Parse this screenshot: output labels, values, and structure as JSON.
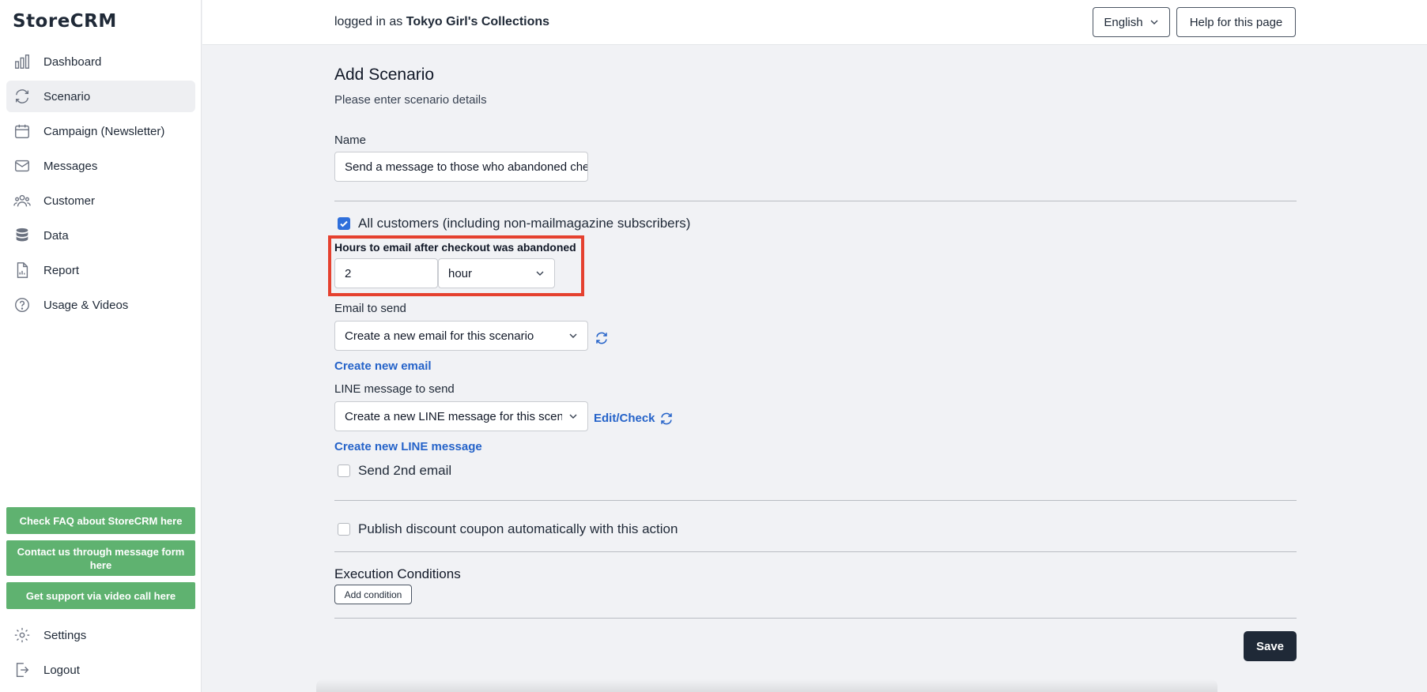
{
  "app": {
    "logo": "StoreCRM"
  },
  "sidebar": {
    "items": [
      {
        "label": "Dashboard",
        "icon": "chart-bars-icon"
      },
      {
        "label": "Scenario",
        "icon": "refresh-icon",
        "active": true
      },
      {
        "label": "Campaign (Newsletter)",
        "icon": "calendar-icon"
      },
      {
        "label": "Messages",
        "icon": "envelope-icon"
      },
      {
        "label": "Customer",
        "icon": "users-icon"
      },
      {
        "label": "Data",
        "icon": "database-icon"
      },
      {
        "label": "Report",
        "icon": "document-chart-icon"
      },
      {
        "label": "Usage & Videos",
        "icon": "question-circle-icon"
      }
    ],
    "help_buttons": [
      "Check FAQ about StoreCRM here",
      "Contact us through message form here",
      "Get support via video call here"
    ],
    "bottom_items": [
      {
        "label": "Settings",
        "icon": "gear-icon"
      },
      {
        "label": "Logout",
        "icon": "logout-icon"
      }
    ]
  },
  "header": {
    "logged_prefix": "logged in as",
    "store_name": "Tokyo Girl's Collections",
    "language": "English",
    "help_button": "Help for this page"
  },
  "form": {
    "title": "Add Scenario",
    "subtitle": "Please enter scenario details",
    "name_label": "Name",
    "name_value": "Send a message to those who abandoned checkout",
    "all_customers_label": "All customers (including non-mailmagazine subscribers)",
    "all_customers_checked": true,
    "hours_label": "Hours to email after checkout was abandoned",
    "hours_value": "2",
    "hours_unit": "hour",
    "email_label": "Email to send",
    "email_selected": "Create a new email for this scenario",
    "create_email_link": "Create new email",
    "line_label": "LINE message to send",
    "line_selected": "Create a new LINE message for this scenario",
    "edit_check_link": "Edit/Check",
    "create_line_link": "Create new LINE message",
    "second_email_label": "Send 2nd email",
    "second_email_checked": false,
    "coupon_label": "Publish discount coupon automatically with this action",
    "coupon_checked": false,
    "execution_title": "Execution Conditions",
    "add_condition": "Add condition",
    "save": "Save"
  },
  "colors": {
    "accent_blue": "#2563c9",
    "help_green": "#5fb270",
    "highlight_red": "#e5412f",
    "save_dark": "#1f2937"
  }
}
